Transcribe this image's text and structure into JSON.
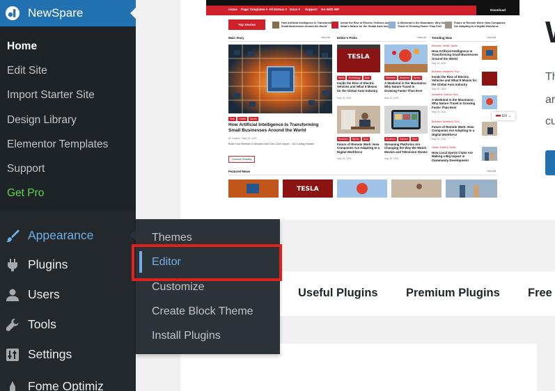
{
  "brand": {
    "label": "NewSpare"
  },
  "submenu": [
    {
      "label": "Home",
      "current": true
    },
    {
      "label": "Edit Site"
    },
    {
      "label": "Import Starter Site"
    },
    {
      "label": "Design Library"
    },
    {
      "label": "Elementor Templates"
    },
    {
      "label": "Support"
    },
    {
      "label": "Get Pro",
      "pro": true
    }
  ],
  "menu": {
    "appearance": "Appearance",
    "plugins": "Plugins",
    "users": "Users",
    "tools": "Tools",
    "settings": "Settings",
    "partial": "Fome Optimiz"
  },
  "flyout": {
    "themes": "Themes",
    "editor": "Editor",
    "customize": "Customize",
    "create_block_theme": "Create Block Theme",
    "install_plugins": "Install Plugins"
  },
  "tabs": {
    "useful": "Useful Plugins",
    "premium": "Premium Plugins",
    "free": "Free w"
  },
  "right_panel": {
    "heading": "W",
    "lines": [
      "Th",
      "ar",
      "cu"
    ]
  },
  "colors": {
    "wp_blue": "#2271b1",
    "sidebar_bg": "#1d2327",
    "flyout_bg": "#2c3338",
    "active_link": "#72aee6",
    "highlight_red": "#e0201b",
    "pro_green": "#5fd44d",
    "news_red": "#d0202a"
  },
  "preview": {
    "nav": [
      "Home",
      "Page Templates ▾",
      "All Demos ▾",
      "Docs ▾",
      "Support",
      "Go With WP"
    ],
    "download": "Download",
    "top_stories": "Top Stories",
    "ticker": [
      "How Artificial Intelligence Is Transforming Small Businesses Around the World",
      "Inside the Rise of Electric Vehicles and What It Means for the Global Auto Industry",
      "A Weekend in the Mountains: Why Nature Travel Is Growing Faster Than Ever",
      "Future of Remote Work: How Companies Are Adapting to a Digital Workforce"
    ],
    "sections": {
      "main": "Main Story",
      "editors": "Editor's Picks",
      "trending": "Trending Now",
      "featured": "Featured News",
      "view_all": "View All"
    },
    "main_story": {
      "tags": [
        "Tech",
        "Health",
        "Sports"
      ],
      "headline": "How Artificial Intelligence Is Transforming Small Businesses Around the World",
      "meta": "AF Deelers  ·  May 15, 2024",
      "excerpt": "Build Your Website in Minutes with One-Click Import – No Coding Hassle!",
      "button": "Continue Reading"
    },
    "editors": [
      {
        "tags": [
          "News",
          "Technology",
          "Auto"
        ],
        "headline": "Inside the Rise of Electric Vehicles and What It Means for the Global Auto Industry",
        "date": "May 15, 2024"
      },
      {
        "tags": [
          "Weekend",
          "Business",
          "Sports"
        ],
        "headline": "A Weekend in the Mountains: Why Nature Travel Is Growing Faster Than Ever",
        "date": "May 15, 2024"
      },
      {
        "tags": [
          "Business",
          "Sports",
          "Tech"
        ],
        "headline": "Future of Remote Work: How Companies Are Adapting to a Digital Workforce",
        "date": "May 15, 2024"
      },
      {
        "tags": [
          "Business",
          "Science",
          "Tech"
        ],
        "headline": "Streaming Platforms Are Changing the Way We Watch Movies and Television Shows",
        "date": "May 15, 2024"
      }
    ],
    "trending": [
      {
        "cat": "Business, Health, Sports",
        "headline": "How Artificial Intelligence Is Transforming Small Businesses Around the World",
        "date": "May 15, 2024"
      },
      {
        "cat": "Business, Newsfeed, Tech",
        "headline": "Inside the Rise of Electric Vehicles and What It Means for the Global Auto Industry",
        "date": "May 15, 2024"
      },
      {
        "cat": "Newsfeed, Science, Tech",
        "headline": "A Weekend in the Mountains: Why Nature Travel Is Growing Faster Than Ever",
        "date": "May 15, 2024"
      },
      {
        "cat": "Business, Newsfeed, Tech",
        "headline": "Future of Remote Work: How Companies Are Adapting to a Digital Workforce",
        "date": "May 15, 2024"
      },
      {
        "cat": "Health, Science, World",
        "headline": "How Local Sports Clubs Are Making a Big Impact in Community Development",
        "date": "May 15, 2024"
      }
    ],
    "tesla": "TESLA",
    "lang": "EN"
  }
}
